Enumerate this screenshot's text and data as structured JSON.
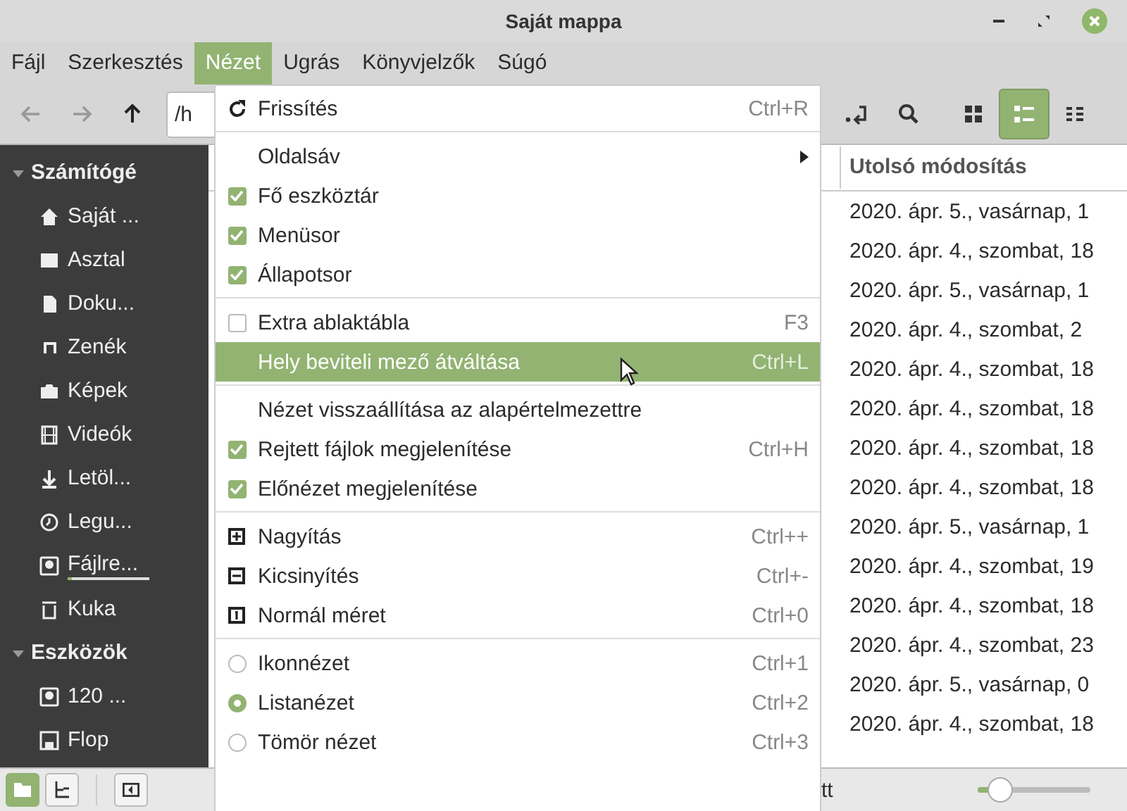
{
  "window": {
    "title": "Saját mappa"
  },
  "menubar": [
    {
      "label": "Fájl",
      "selected": false
    },
    {
      "label": "Szerkesztés",
      "selected": false
    },
    {
      "label": "Nézet",
      "selected": true
    },
    {
      "label": "Ugrás",
      "selected": false
    },
    {
      "label": "Könyvjelzők",
      "selected": false
    },
    {
      "label": "Súgó",
      "selected": false
    }
  ],
  "toolbar": {
    "location": "/h",
    "view_buttons": [
      {
        "kind": "icons",
        "selected": false
      },
      {
        "kind": "list",
        "selected": true
      },
      {
        "kind": "compact",
        "selected": false
      }
    ]
  },
  "sidebar": {
    "sections": [
      {
        "title": "Számítógé",
        "expanded": true,
        "items": [
          {
            "label": "Saját ...",
            "kind": "home"
          },
          {
            "label": "Asztal",
            "kind": "desktop"
          },
          {
            "label": "Doku...",
            "kind": "document"
          },
          {
            "label": "Zenék",
            "kind": "music"
          },
          {
            "label": "Képek",
            "kind": "camera"
          },
          {
            "label": "Videók",
            "kind": "film"
          },
          {
            "label": "Letöl...",
            "kind": "download"
          },
          {
            "label": "Legu...",
            "kind": "clock"
          },
          {
            "label": "Fájlre...",
            "kind": "drive",
            "level": 0.05
          },
          {
            "label": "Kuka",
            "kind": "trash"
          }
        ]
      },
      {
        "title": "Eszközök",
        "expanded": true,
        "items": [
          {
            "label": "120 ...",
            "kind": "drive"
          },
          {
            "label": "Flop",
            "kind": "floppy"
          }
        ]
      }
    ]
  },
  "table": {
    "columns": [
      "Utolsó módosítás"
    ],
    "rows": [
      "2020. ápr. 5., vasárnap, 1",
      "2020. ápr. 4., szombat, 18",
      "2020. ápr. 5., vasárnap, 1",
      "2020. ápr. 4., szombat, 2",
      "2020. ápr. 4., szombat, 18",
      "2020. ápr. 4., szombat, 18",
      "2020. ápr. 4., szombat, 18",
      "2020. ápr. 4., szombat, 18",
      "2020. ápr. 5., vasárnap, 1",
      "2020. ápr. 4., szombat, 19",
      "2020. ápr. 4., szombat, 18",
      "2020. ápr. 4., szombat, 23",
      "2020. ápr. 5., vasárnap, 0",
      "2020. ápr. 4., szombat, 18"
    ]
  },
  "bottom_bar": {
    "pane_buttons": [
      {
        "kind": "places",
        "selected": true
      },
      {
        "kind": "tree",
        "selected": false
      }
    ],
    "status": "tt",
    "zoom": {
      "level": 0.2
    }
  },
  "menu": [
    {
      "kind": "refresh",
      "label": "Frissítés",
      "shortcut": "Ctrl+R",
      "selected": false
    },
    {
      "kind": "separator"
    },
    {
      "kind": "submenu",
      "label": "Oldalsáv",
      "selected": false
    },
    {
      "kind": "check",
      "label": "Fő eszköztár",
      "checked": true,
      "selected": false
    },
    {
      "kind": "check",
      "label": "Menüsor",
      "checked": true,
      "selected": false
    },
    {
      "kind": "check",
      "label": "Állapotsor",
      "checked": true,
      "selected": false
    },
    {
      "kind": "separator"
    },
    {
      "kind": "check",
      "label": "Extra ablaktábla",
      "shortcut": "F3",
      "checked": false,
      "selected": false
    },
    {
      "kind": "plain",
      "label": "Hely beviteli mező átváltása",
      "shortcut": "Ctrl+L",
      "selected": true
    },
    {
      "kind": "separator"
    },
    {
      "kind": "plain",
      "label": "Nézet visszaállítása az alapértelmezettre",
      "selected": false
    },
    {
      "kind": "check",
      "label": "Rejtett fájlok megjelenítése",
      "shortcut": "Ctrl+H",
      "checked": true,
      "selected": false
    },
    {
      "kind": "check",
      "label": "Előnézet megjelenítése",
      "checked": true,
      "selected": false
    },
    {
      "kind": "separator"
    },
    {
      "kind": "zoom_in",
      "label": "Nagyítás",
      "shortcut": "Ctrl++",
      "selected": false
    },
    {
      "kind": "zoom_out",
      "label": "Kicsinyítés",
      "shortcut": "Ctrl+-",
      "selected": false
    },
    {
      "kind": "zoom_normal",
      "label": "Normál méret",
      "shortcut": "Ctrl+0",
      "selected": false
    },
    {
      "kind": "separator"
    },
    {
      "kind": "radio",
      "label": "Ikonnézet",
      "shortcut": "Ctrl+1",
      "checked": false,
      "selected": false
    },
    {
      "kind": "radio",
      "label": "Listanézet",
      "shortcut": "Ctrl+2",
      "checked": true,
      "selected": false
    },
    {
      "kind": "radio",
      "label": "Tömör nézet",
      "shortcut": "Ctrl+3",
      "checked": false,
      "selected": false
    }
  ]
}
